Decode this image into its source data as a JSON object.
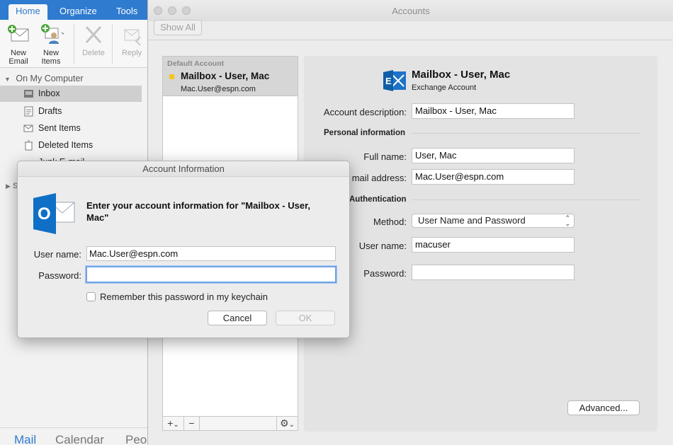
{
  "outlook": {
    "tabs": [
      "Home",
      "Organize",
      "Tools"
    ],
    "ribbon": {
      "new_email": "New\nEmail",
      "new_items": "New\nItems",
      "delete": "Delete",
      "reply": "Reply"
    },
    "folders_header": "On My Computer",
    "folders": [
      "Inbox",
      "Drafts",
      "Sent Items",
      "Deleted Items",
      "Junk E-mail"
    ],
    "sidebar_fragment": "S",
    "bottom_nav": [
      "Mail",
      "Calendar",
      "Peo"
    ]
  },
  "accounts": {
    "title": "Accounts",
    "show_all": "Show All",
    "list": {
      "default_label": "Default Account",
      "name": "Mailbox - User, Mac",
      "email": "Mac.User@espn.com"
    },
    "toolbar": {
      "add": "+",
      "add_chevron": "⌄",
      "remove": "−",
      "gear": "⚙",
      "gear_chevron": "⌄"
    },
    "detail": {
      "account_name": "Mailbox - User, Mac",
      "account_type": "Exchange Account",
      "account_description_label": "Account description:",
      "account_description": "Mailbox - User, Mac",
      "personal_info_header": "Personal information",
      "full_name_label": "Full name:",
      "full_name": "User, Mac",
      "email_label": "mail address:",
      "email": "Mac.User@espn.com",
      "auth_header": "Authentication",
      "method_label": "Method:",
      "method": "User Name and Password",
      "username_label": "User name:",
      "username": "macuser",
      "password_label": "Password:",
      "password": "",
      "advanced_button": "Advanced..."
    }
  },
  "dialog": {
    "title": "Account Information",
    "message": "Enter your account information for \"Mailbox - User, Mac\"",
    "username_label": "User name:",
    "username": "Mac.User@espn.com",
    "password_label": "Password:",
    "password": "",
    "remember_label": "Remember this password in my keychain",
    "cancel_button": "Cancel",
    "ok_button": "OK"
  },
  "colors": {
    "ribbon_blue": "#2f7bcf",
    "outlook_icon": "#0f6fc6",
    "exchange_icon": "#1e73c8",
    "account_dot": "#f5c518",
    "focus_ring": "#6fa3e6"
  }
}
